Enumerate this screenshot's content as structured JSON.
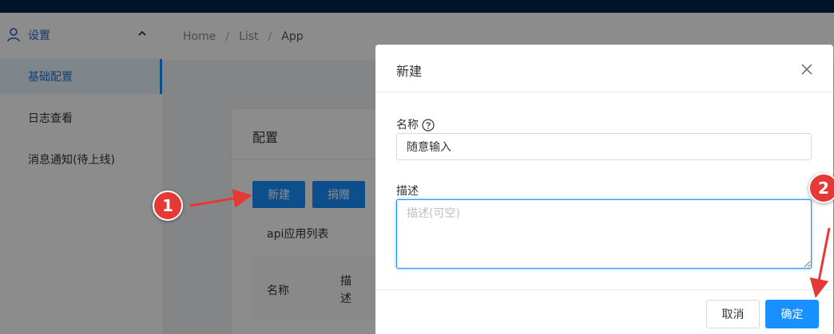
{
  "sidebar": {
    "section_title": "设置",
    "items": [
      {
        "label": "基础配置",
        "active": true
      },
      {
        "label": "日志查看",
        "active": false
      },
      {
        "label": "消息通知(待上线)",
        "active": false
      }
    ]
  },
  "breadcrumb": [
    "Home",
    "List",
    "App"
  ],
  "breadcrumb_separator": "/",
  "panel": {
    "title": "配置",
    "new_button": "新建",
    "donate_button": "捐赠",
    "list_title": "api应用列表",
    "columns": [
      "名称",
      "描述"
    ]
  },
  "modal": {
    "title": "新建",
    "name_label": "名称",
    "name_value": "随意输入",
    "desc_label": "描述",
    "desc_placeholder": "描述(可空)",
    "cancel_button": "取消",
    "ok_button": "确定"
  },
  "annotations": {
    "step1": "1",
    "step2": "2"
  },
  "colors": {
    "primary": "#1890ff",
    "topbar": "#001529",
    "annotation": "#e53935"
  }
}
